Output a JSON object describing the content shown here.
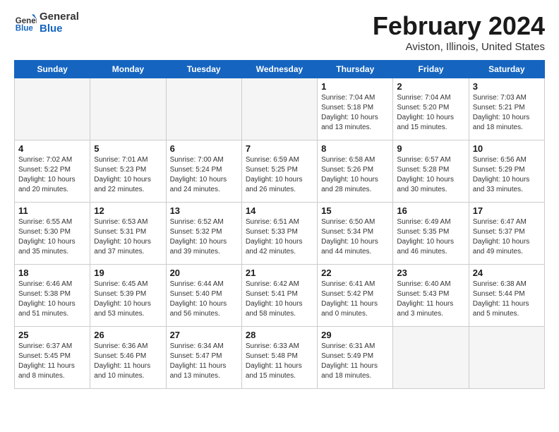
{
  "logo": {
    "line1": "General",
    "line2": "Blue"
  },
  "title": "February 2024",
  "location": "Aviston, Illinois, United States",
  "days_header": [
    "Sunday",
    "Monday",
    "Tuesday",
    "Wednesday",
    "Thursday",
    "Friday",
    "Saturday"
  ],
  "weeks": [
    [
      {
        "day": "",
        "info": ""
      },
      {
        "day": "",
        "info": ""
      },
      {
        "day": "",
        "info": ""
      },
      {
        "day": "",
        "info": ""
      },
      {
        "day": "1",
        "info": "Sunrise: 7:04 AM\nSunset: 5:18 PM\nDaylight: 10 hours\nand 13 minutes."
      },
      {
        "day": "2",
        "info": "Sunrise: 7:04 AM\nSunset: 5:20 PM\nDaylight: 10 hours\nand 15 minutes."
      },
      {
        "day": "3",
        "info": "Sunrise: 7:03 AM\nSunset: 5:21 PM\nDaylight: 10 hours\nand 18 minutes."
      }
    ],
    [
      {
        "day": "4",
        "info": "Sunrise: 7:02 AM\nSunset: 5:22 PM\nDaylight: 10 hours\nand 20 minutes."
      },
      {
        "day": "5",
        "info": "Sunrise: 7:01 AM\nSunset: 5:23 PM\nDaylight: 10 hours\nand 22 minutes."
      },
      {
        "day": "6",
        "info": "Sunrise: 7:00 AM\nSunset: 5:24 PM\nDaylight: 10 hours\nand 24 minutes."
      },
      {
        "day": "7",
        "info": "Sunrise: 6:59 AM\nSunset: 5:25 PM\nDaylight: 10 hours\nand 26 minutes."
      },
      {
        "day": "8",
        "info": "Sunrise: 6:58 AM\nSunset: 5:26 PM\nDaylight: 10 hours\nand 28 minutes."
      },
      {
        "day": "9",
        "info": "Sunrise: 6:57 AM\nSunset: 5:28 PM\nDaylight: 10 hours\nand 30 minutes."
      },
      {
        "day": "10",
        "info": "Sunrise: 6:56 AM\nSunset: 5:29 PM\nDaylight: 10 hours\nand 33 minutes."
      }
    ],
    [
      {
        "day": "11",
        "info": "Sunrise: 6:55 AM\nSunset: 5:30 PM\nDaylight: 10 hours\nand 35 minutes."
      },
      {
        "day": "12",
        "info": "Sunrise: 6:53 AM\nSunset: 5:31 PM\nDaylight: 10 hours\nand 37 minutes."
      },
      {
        "day": "13",
        "info": "Sunrise: 6:52 AM\nSunset: 5:32 PM\nDaylight: 10 hours\nand 39 minutes."
      },
      {
        "day": "14",
        "info": "Sunrise: 6:51 AM\nSunset: 5:33 PM\nDaylight: 10 hours\nand 42 minutes."
      },
      {
        "day": "15",
        "info": "Sunrise: 6:50 AM\nSunset: 5:34 PM\nDaylight: 10 hours\nand 44 minutes."
      },
      {
        "day": "16",
        "info": "Sunrise: 6:49 AM\nSunset: 5:35 PM\nDaylight: 10 hours\nand 46 minutes."
      },
      {
        "day": "17",
        "info": "Sunrise: 6:47 AM\nSunset: 5:37 PM\nDaylight: 10 hours\nand 49 minutes."
      }
    ],
    [
      {
        "day": "18",
        "info": "Sunrise: 6:46 AM\nSunset: 5:38 PM\nDaylight: 10 hours\nand 51 minutes."
      },
      {
        "day": "19",
        "info": "Sunrise: 6:45 AM\nSunset: 5:39 PM\nDaylight: 10 hours\nand 53 minutes."
      },
      {
        "day": "20",
        "info": "Sunrise: 6:44 AM\nSunset: 5:40 PM\nDaylight: 10 hours\nand 56 minutes."
      },
      {
        "day": "21",
        "info": "Sunrise: 6:42 AM\nSunset: 5:41 PM\nDaylight: 10 hours\nand 58 minutes."
      },
      {
        "day": "22",
        "info": "Sunrise: 6:41 AM\nSunset: 5:42 PM\nDaylight: 11 hours\nand 0 minutes."
      },
      {
        "day": "23",
        "info": "Sunrise: 6:40 AM\nSunset: 5:43 PM\nDaylight: 11 hours\nand 3 minutes."
      },
      {
        "day": "24",
        "info": "Sunrise: 6:38 AM\nSunset: 5:44 PM\nDaylight: 11 hours\nand 5 minutes."
      }
    ],
    [
      {
        "day": "25",
        "info": "Sunrise: 6:37 AM\nSunset: 5:45 PM\nDaylight: 11 hours\nand 8 minutes."
      },
      {
        "day": "26",
        "info": "Sunrise: 6:36 AM\nSunset: 5:46 PM\nDaylight: 11 hours\nand 10 minutes."
      },
      {
        "day": "27",
        "info": "Sunrise: 6:34 AM\nSunset: 5:47 PM\nDaylight: 11 hours\nand 13 minutes."
      },
      {
        "day": "28",
        "info": "Sunrise: 6:33 AM\nSunset: 5:48 PM\nDaylight: 11 hours\nand 15 minutes."
      },
      {
        "day": "29",
        "info": "Sunrise: 6:31 AM\nSunset: 5:49 PM\nDaylight: 11 hours\nand 18 minutes."
      },
      {
        "day": "",
        "info": ""
      },
      {
        "day": "",
        "info": ""
      }
    ]
  ]
}
